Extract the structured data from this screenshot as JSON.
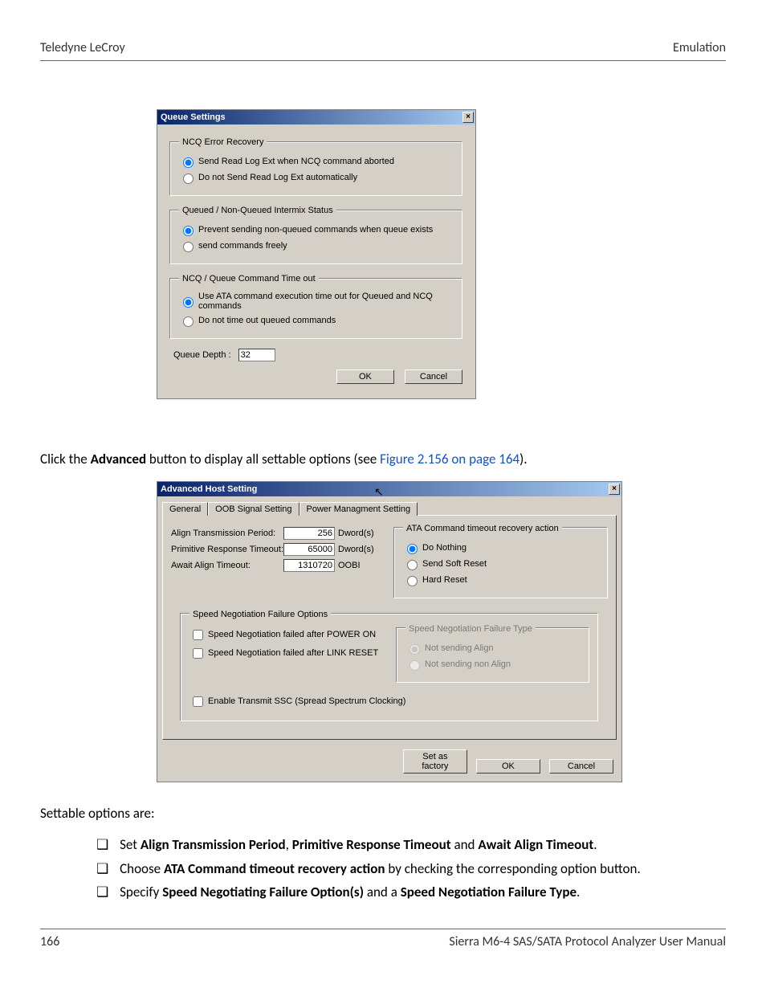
{
  "header": {
    "left": "Teledyne LeCroy",
    "right": "Emulation"
  },
  "footer": {
    "page": "166",
    "manual": "Sierra M6-4 SAS/SATA Protocol Analyzer User Manual"
  },
  "qs": {
    "title": "Queue Settings",
    "ncq_recovery": {
      "legend": "NCQ Error Recovery",
      "opt1": "Send Read Log Ext when NCQ command aborted",
      "opt2": "Do not Send Read Log Ext automatically"
    },
    "intermix": {
      "legend": "Queued / Non-Queued Intermix Status",
      "opt1": "Prevent sending non-queued commands when queue exists",
      "opt2": "send commands freely"
    },
    "timeout": {
      "legend": "NCQ / Queue Command Time out",
      "opt1": "Use ATA command execution time out for Queued and NCQ commands",
      "opt2": "Do not time out queued commands"
    },
    "queue_depth_label": "Queue Depth :",
    "queue_depth_value": "32",
    "ok": "OK",
    "cancel": "Cancel"
  },
  "doc": {
    "p1_pre": "Click the ",
    "p1_b": "Advanced",
    "p1_mid": " button to display all settable options (see ",
    "p1_link": "Figure 2.156 on page 164",
    "p1_post": ").",
    "p2": "Settable options are:",
    "li1_pre": "Set ",
    "li1_b1": "Align Transmission Period",
    "li1_sep1": ", ",
    "li1_b2": "Primitive Response Timeout",
    "li1_sep2": " and ",
    "li1_b3": "Await Align Timeout",
    "li1_post": ".",
    "li2_pre": "Choose ",
    "li2_b": "ATA Command timeout recovery action",
    "li2_post": " by checking the corresponding option button.",
    "li3_pre": "Specify ",
    "li3_b1": "Speed Negotiating Failure Option(s)",
    "li3_sep": " and a ",
    "li3_b2": "Speed Negotiation Failure Type",
    "li3_post": "."
  },
  "ahs": {
    "title": "Advanced Host Setting",
    "tabs": {
      "general": "General",
      "oob": "OOB Signal Setting",
      "pm": "Power Managment Setting"
    },
    "align": {
      "r1_label": "Align Transmission Period:",
      "r1_value": "256",
      "r1_unit": "Dword(s)",
      "r2_label": "Primitive Response Timeout:",
      "r2_value": "65000",
      "r2_unit": "Dword(s)",
      "r3_label": "Await Align Timeout:",
      "r3_value": "1310720",
      "r3_unit": "OOBI"
    },
    "ata_action": {
      "legend": "ATA Command timeout recovery action",
      "opt1": "Do Nothing",
      "opt2": "Send Soft Reset",
      "opt3": "Hard Reset"
    },
    "snfo": {
      "legend": "Speed Negotiation Failure Options",
      "opt1": "Speed Negotiation failed after POWER ON",
      "opt2": "Speed Negotiation failed after LINK RESET"
    },
    "snft": {
      "legend": "Speed Negotiation Failure Type",
      "opt1": "Not sending Align",
      "opt2": "Not sending non Align"
    },
    "ssc": "Enable Transmit SSC (Spread Spectrum Clocking)",
    "set_factory": "Set as factory",
    "ok": "OK",
    "cancel": "Cancel"
  }
}
